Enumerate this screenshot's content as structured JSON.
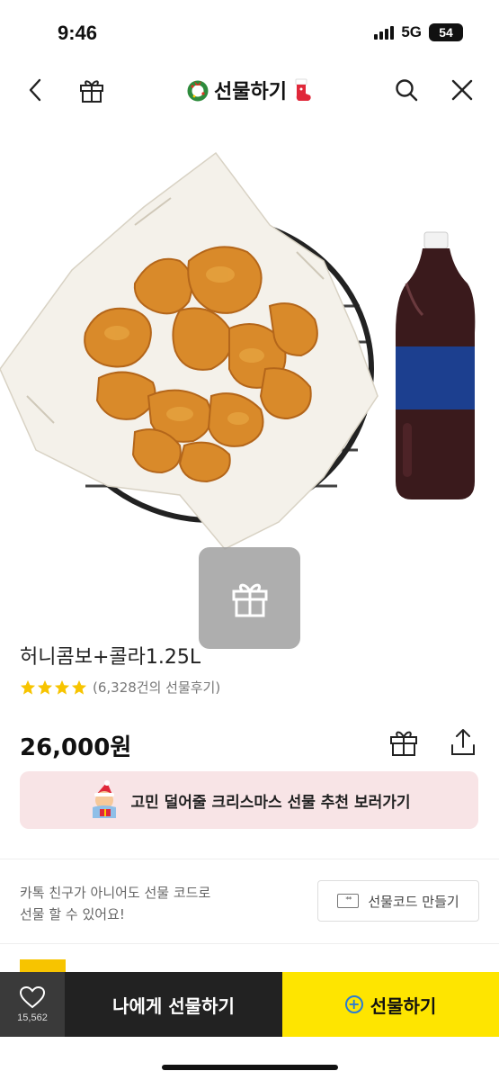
{
  "status_bar": {
    "time": "9:46",
    "network": "5G",
    "battery": "54"
  },
  "nav": {
    "title": "선물하기",
    "back_icon": "chevron-left-icon",
    "gift_icon": "gift-icon",
    "search_icon": "search-icon",
    "close_icon": "close-icon"
  },
  "product": {
    "name": "허니콤보+콜라1.25L",
    "rating_stars": 4,
    "review_text": "(6,328건의 선물후기)",
    "price": "26,000원"
  },
  "banner": {
    "text": "고민 덜어줄 크리스마스 선물 추천 보러가기"
  },
  "gift_code": {
    "description_line1": "카톡 친구가 아니어도 선물 코드로",
    "description_line2": "선물 할 수 있어요!",
    "button_label": "선물코드 만들기",
    "icon_text": "**"
  },
  "bottom_bar": {
    "like_count": "15,562",
    "self_gift_label": "나에게 선물하기",
    "gift_label": "선물하기"
  },
  "colors": {
    "accent_yellow": "#fee500",
    "star": "#f7c400",
    "banner_bg": "#f8e4e6",
    "dark": "#222222"
  }
}
